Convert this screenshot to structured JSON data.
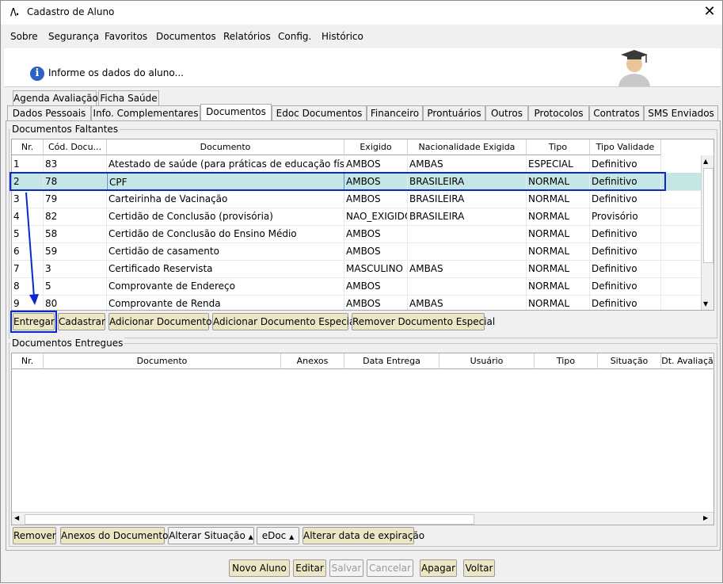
{
  "window": {
    "title": "Cadastro de Aluno",
    "logo": "/\\\\.",
    "close": "✕"
  },
  "menu": [
    "Sobre",
    "Segurança",
    "Favoritos",
    "Documentos",
    "Relatórios",
    "Config.",
    "Histórico"
  ],
  "banner": {
    "text": "Informe os dados do aluno...",
    "icon": "info-icon"
  },
  "tabs_row1": [
    "Agenda Avaliação",
    "Ficha Saúde"
  ],
  "tabs_row2": [
    "Dados Pessoais",
    "Info. Complementares",
    "Documentos",
    "Edoc Documentos",
    "Financeiro",
    "Prontuários",
    "Outros",
    "Protocolos",
    "Contratos",
    "SMS Enviados"
  ],
  "active_tab": "Documentos",
  "faltantes": {
    "label": "Documentos Faltantes",
    "columns": [
      "Nr.",
      "Cód. Docu...",
      "Documento",
      "Exigido",
      "Nacionalidade Exigida",
      "Tipo",
      "Tipo Validade"
    ],
    "rows": [
      [
        "1",
        "83",
        "Atestado de saúde (para práticas de educação física)",
        "AMBOS",
        "AMBAS",
        "ESPECIAL",
        "Definitivo"
      ],
      [
        "2",
        "78",
        "CPF",
        "AMBOS",
        "BRASILEIRA",
        "NORMAL",
        "Definitivo"
      ],
      [
        "3",
        "79",
        "Carteirinha de Vacinação",
        "AMBOS",
        "BRASILEIRA",
        "NORMAL",
        "Definitivo"
      ],
      [
        "4",
        "82",
        "Certidão de Conclusão (provisória)",
        "NAO_EXIGIDO",
        "BRASILEIRA",
        "NORMAL",
        "Provisório"
      ],
      [
        "5",
        "58",
        "Certidão de Conclusão do Ensino Médio",
        "AMBOS",
        "",
        "NORMAL",
        "Definitivo"
      ],
      [
        "6",
        "59",
        "Certidão de casamento",
        "AMBOS",
        "",
        "NORMAL",
        "Definitivo"
      ],
      [
        "7",
        "3",
        "Certificado Reservista",
        "MASCULINO",
        "AMBAS",
        "NORMAL",
        "Definitivo"
      ],
      [
        "8",
        "5",
        "Comprovante de Endereço",
        "AMBOS",
        "",
        "NORMAL",
        "Definitivo"
      ],
      [
        "9",
        "80",
        "Comprovante de Renda",
        "AMBOS",
        "AMBAS",
        "NORMAL",
        "Definitivo"
      ]
    ],
    "selected_row": 1,
    "buttons": [
      "Entregar",
      "Cadastrar",
      "Adicionar Documento",
      "Adicionar Documento Especial",
      "Remover Documento Especial"
    ]
  },
  "entregues": {
    "label": "Documentos Entregues",
    "columns": [
      "Nr.",
      "Documento",
      "Anexos",
      "Data Entrega",
      "Usuário",
      "Tipo",
      "Situação",
      "Dt. Avaliaçã"
    ],
    "buttons": {
      "remover": "Remover",
      "anexos": "Anexos do Documento",
      "alterar_situacao": "Alterar Situação",
      "edoc": "eDoc",
      "alterar_data": "Alterar data de expiração"
    }
  },
  "footer_buttons": {
    "novo": "Novo Aluno",
    "editar": "Editar",
    "salvar": "Salvar",
    "cancelar": "Cancelar",
    "apagar": "Apagar",
    "voltar": "Voltar"
  },
  "colors": {
    "accent": "#0b27d0",
    "selection": "#c4e6e4",
    "button": "#ede6c4"
  }
}
